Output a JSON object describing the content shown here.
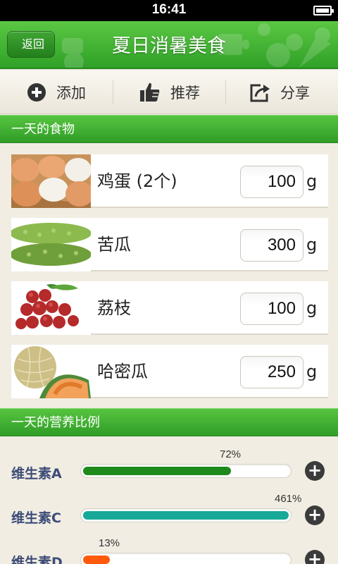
{
  "status_bar": {
    "time": "16:41"
  },
  "header": {
    "back_label": "返回",
    "title": "夏日消暑美食"
  },
  "toolbar": {
    "add_label": "添加",
    "recommend_label": "推荐",
    "share_label": "分享"
  },
  "foods_section": {
    "title": "一天的食物",
    "items": [
      {
        "name": "鸡蛋 (2个)",
        "amount": "100",
        "unit": "g"
      },
      {
        "name": "苦瓜",
        "amount": "300",
        "unit": "g"
      },
      {
        "name": "荔枝",
        "amount": "100",
        "unit": "g"
      },
      {
        "name": "哈密瓜",
        "amount": "250",
        "unit": "g"
      }
    ]
  },
  "nutrition_section": {
    "title": "一天的营养比例",
    "items": [
      {
        "label": "维生素A",
        "percent_label": "72%",
        "fill_fraction": 0.72,
        "color": "#1f8a1c"
      },
      {
        "label": "维生素C",
        "percent_label": "461%",
        "fill_fraction": 1.0,
        "color": "#17a897"
      },
      {
        "label": "维生素D",
        "percent_label": "13%",
        "fill_fraction": 0.13,
        "color": "#ff5a0c"
      }
    ]
  },
  "colors": {
    "brand_green": "#3fb02f",
    "bg": "#f1ede3"
  }
}
